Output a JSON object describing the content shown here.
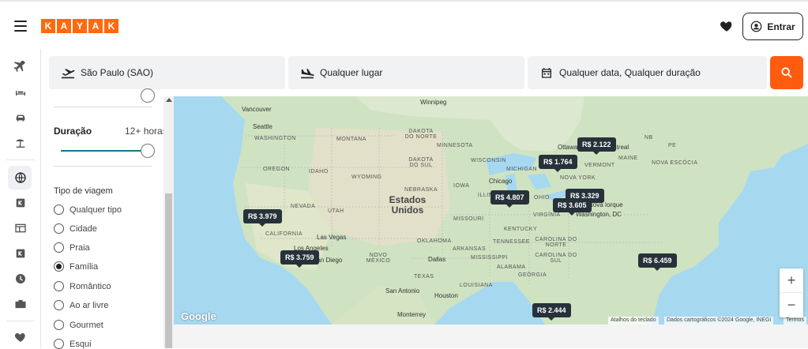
{
  "header": {
    "logo_letters": [
      "K",
      "A",
      "Y",
      "A",
      "K"
    ],
    "login_label": "Entrar",
    "brand_color": "#ff690f"
  },
  "rail": {
    "icons": [
      "flight-icon",
      "hotel-icon",
      "car-icon",
      "beach-icon",
      "globe-icon",
      "kayak-k-icon",
      "list-icon",
      "kayak-k-icon",
      "clock-icon",
      "briefcase-icon",
      "heart-icon"
    ]
  },
  "search": {
    "origin": "São Paulo (SAO)",
    "destination": "Qualquer lugar",
    "dates": "Qualquer data, Qualquer duração"
  },
  "filters": {
    "duration_title": "Duração",
    "duration_value": "12+ horas",
    "trip_type_title": "Tipo de viagem",
    "trip_types": [
      {
        "label": "Qualquer tipo",
        "selected": false
      },
      {
        "label": "Cidade",
        "selected": false
      },
      {
        "label": "Praia",
        "selected": false
      },
      {
        "label": "Família",
        "selected": true
      },
      {
        "label": "Romântico",
        "selected": false
      },
      {
        "label": "Ao ar livre",
        "selected": false
      },
      {
        "label": "Gourmet",
        "selected": false
      },
      {
        "label": "Esqui",
        "selected": false
      }
    ]
  },
  "map": {
    "pins": [
      "R$ 2.122",
      "R$ 1.764",
      "R$ 4.807",
      "R$ 3.329",
      "R$ 3.605",
      "R$ 3.979",
      "R$ 3.759",
      "R$ 6.459",
      "R$ 2.444"
    ],
    "country_label": "Estados Unidos",
    "states": [
      "WASHINGTON",
      "OREGON",
      "IDAHO",
      "MONTANA",
      "WYOMING",
      "NEVADA",
      "UTAH",
      "CALIFORNIA",
      "NOVO MÉXICO",
      "DAKOTA DO NORTE",
      "DAKOTA DO SUL",
      "NEBRASKA",
      "MINNESOTA",
      "IOWA",
      "WISCONSIN",
      "MICHIGAN",
      "ILLINOIS",
      "MISSOURI",
      "ARKANSAS",
      "OKLAHOMA",
      "TEXAS",
      "LOUISIANA",
      "MISSISSIPPI",
      "ALABAMA",
      "GEÓRGIA",
      "TENNESSEE",
      "KENTUCKY",
      "VIRGÍNIA",
      "CAROLINA DO NORTE",
      "CAROLINA DO SUL",
      "VERMONT",
      "MAINE",
      "NOVA YORK",
      "NB",
      "PE",
      "NOVA ESCÓCIA",
      "OHIO"
    ],
    "cities": [
      "Vancouver",
      "Seattle",
      "Winnipeg",
      "Las Vegas",
      "Los Angeles",
      "San Diego",
      "Dallas",
      "San Antonio",
      "Houston",
      "Monterrey",
      "Chicago",
      "Ottawa",
      "Montreal",
      "Washington, DC",
      "Nova Iorque"
    ],
    "google_label": "Google",
    "attrib_shortcuts": "Atalhos do teclado",
    "attrib_data": "Dados cartográficos ©2024 Google, INEGI",
    "attrib_terms": "Termos",
    "zoom_in": "+",
    "zoom_out": "−",
    "land_color": "#cfe3c2",
    "water_color": "#a6d8f0"
  }
}
